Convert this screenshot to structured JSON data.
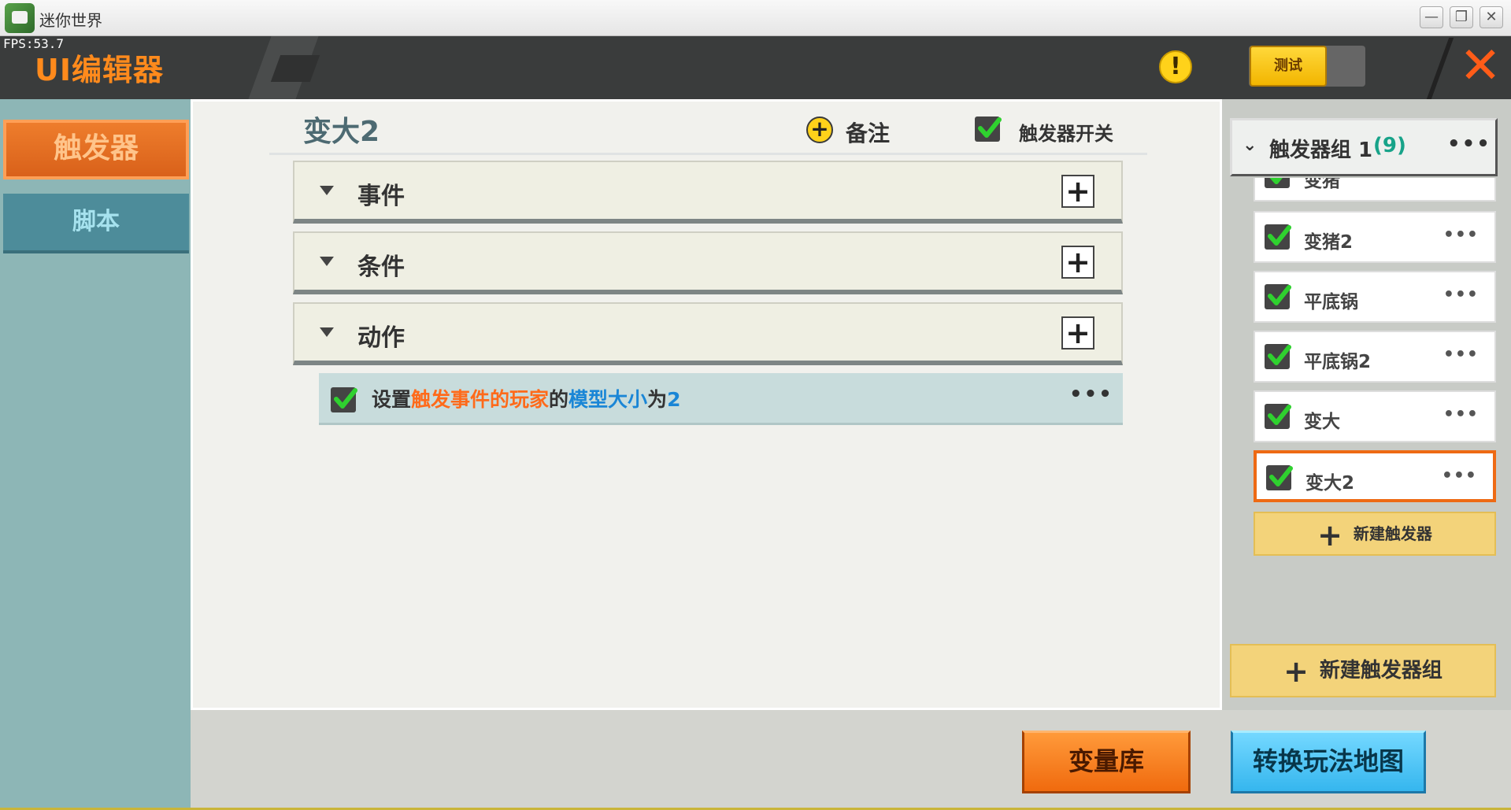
{
  "window": {
    "title": "迷你世界",
    "minimize": "—",
    "restore": "❐",
    "close": "✕"
  },
  "header": {
    "fps": "FPS:53.7",
    "editor_title": "UI编辑器",
    "warning": "!",
    "test_label": "测试",
    "close": "✕"
  },
  "sidebar": {
    "tabs": [
      {
        "label": "触发器",
        "active": true
      },
      {
        "label": "脚本",
        "active": false
      }
    ]
  },
  "main": {
    "trigger_name": "变大2",
    "note_icon": "+",
    "note_label": "备注",
    "trigger_switch_label": "触发器开关",
    "trigger_switch_checked": true,
    "sections": [
      {
        "label": "事件"
      },
      {
        "label": "条件"
      },
      {
        "label": "动作"
      }
    ],
    "action": {
      "checked": true,
      "parts": [
        "设置",
        "触发事件的玩家",
        "的",
        "模型大小",
        "为",
        "2"
      ],
      "more": "•••"
    }
  },
  "right_panel": {
    "group_chevron": "⌄",
    "group_name": "触发器组 1",
    "group_count": "(9)",
    "group_more": "•••",
    "triggers": [
      {
        "name": "变猪",
        "checked": true,
        "selected": false
      },
      {
        "name": "变猪2",
        "checked": true,
        "selected": false
      },
      {
        "name": "平底锅",
        "checked": true,
        "selected": false
      },
      {
        "name": "平底锅2",
        "checked": true,
        "selected": false
      },
      {
        "name": "变大",
        "checked": true,
        "selected": false
      },
      {
        "name": "变大2",
        "checked": true,
        "selected": true
      }
    ],
    "item_more": "•••",
    "new_trigger_label": "新建触发器",
    "new_group_label": "新建触发器组",
    "plus": "+"
  },
  "bottom": {
    "variable_library_label": "变量库",
    "convert_map_label": "转换玩法地图"
  },
  "colors": {
    "accent_orange": "#ff8a1c",
    "highlight_orange": "#ff6a1a",
    "highlight_blue": "#1a86d6",
    "count_green": "#17a389",
    "check_green": "#2fd12f"
  }
}
